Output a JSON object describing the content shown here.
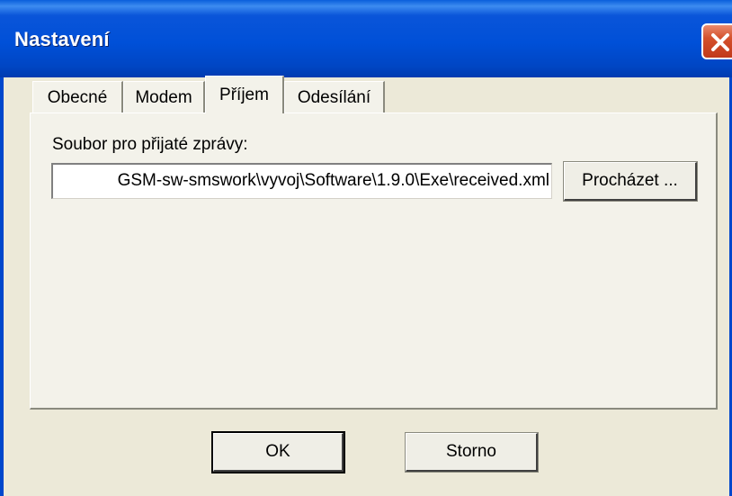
{
  "window": {
    "title": "Nastavení"
  },
  "tabs": [
    {
      "label": "Obecné",
      "active": false
    },
    {
      "label": "Modem",
      "active": false
    },
    {
      "label": "Příjem",
      "active": true
    },
    {
      "label": "Odesílání",
      "active": false
    }
  ],
  "receive": {
    "file_label": "Soubor pro přijaté zprávy:",
    "file_value": "GSM-sw-smswork\\vyvoj\\Software\\1.9.0\\Exe\\received.xml",
    "browse_label": "Procházet ..."
  },
  "footer": {
    "ok_label": "OK",
    "cancel_label": "Storno"
  },
  "colors": {
    "title_bar": "#0050d8",
    "close_button": "#d4502c",
    "dialog_face": "#ece9d8"
  }
}
